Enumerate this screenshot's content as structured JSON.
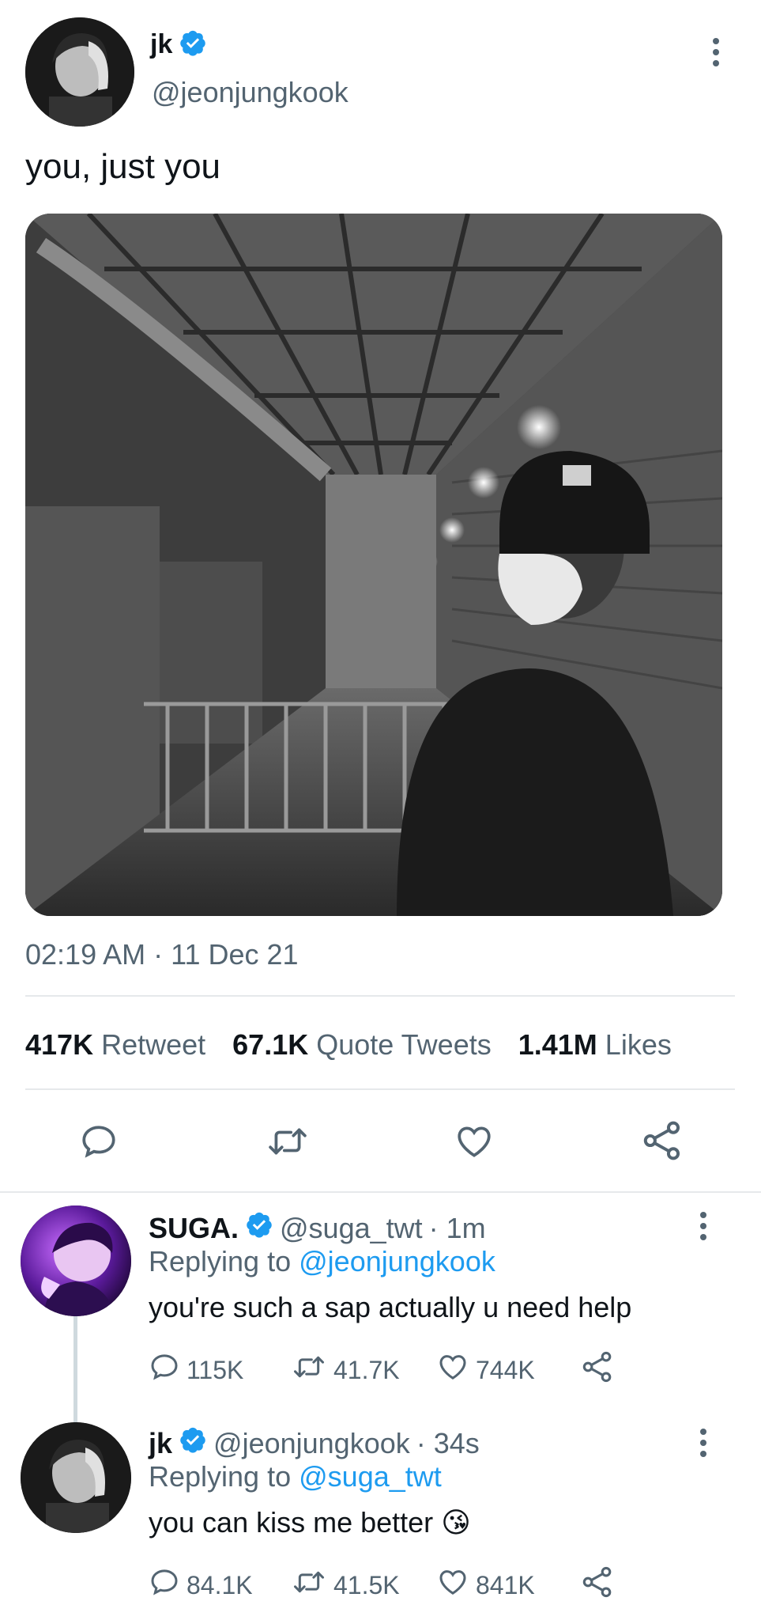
{
  "tweet": {
    "display_name": "jk",
    "handle": "@jeonjungkook",
    "text": "you, just you",
    "timestamp": "02:19 AM · 11 Dec 21",
    "stats": {
      "retweets": "417K",
      "retweets_label": "Retweet",
      "quotes": "67.1K",
      "quotes_label": "Quote Tweets",
      "likes": "1.41M",
      "likes_label": "Likes"
    }
  },
  "replies": [
    {
      "display_name": "SUGA.",
      "handle": "@suga_twt",
      "time": "· 1m",
      "replying_prefix": "Replying to",
      "replying_to": "@jeonjungkook",
      "text": "you're such a sap actually u need help",
      "replies": "115K",
      "retweets": "41.7K",
      "likes": "744K"
    },
    {
      "display_name": "jk",
      "handle": "@jeonjungkook",
      "time": "· 34s",
      "replying_prefix": "Replying to",
      "replying_to": "@suga_twt",
      "text": "you can kiss me better",
      "emoji": "😘",
      "replies": "84.1K",
      "retweets": "41.5K",
      "likes": "841K"
    }
  ],
  "colors": {
    "accent": "#1d9bf0",
    "muted": "#536471",
    "divider": "#e6e9eb",
    "thread_line": "#cfd9de"
  },
  "icons": [
    "verified-badge-icon",
    "more-options-icon",
    "reply-icon",
    "retweet-icon",
    "like-icon",
    "share-icon"
  ]
}
